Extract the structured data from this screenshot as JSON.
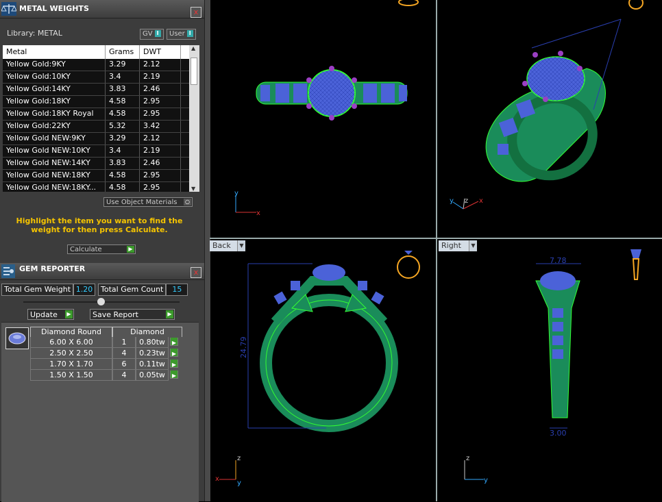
{
  "metal_panel": {
    "title": "METAL WEIGHTS",
    "close": "x",
    "library_label": "Library: METAL",
    "toggle_gv": "GV",
    "toggle_user": "User",
    "toggle_mark": "I",
    "columns": [
      "Metal",
      "Grams",
      "DWT"
    ],
    "rows": [
      {
        "metal": "Yellow Gold:9KY",
        "grams": "3.29",
        "dwt": "2.12"
      },
      {
        "metal": "Yellow Gold:10KY",
        "grams": "3.4",
        "dwt": "2.19"
      },
      {
        "metal": "Yellow Gold:14KY",
        "grams": "3.83",
        "dwt": "2.46"
      },
      {
        "metal": "Yellow Gold:18KY",
        "grams": "4.58",
        "dwt": "2.95"
      },
      {
        "metal": "Yellow Gold:18KY Royal",
        "grams": "4.58",
        "dwt": "2.95"
      },
      {
        "metal": "Yellow Gold:22KY",
        "grams": "5.32",
        "dwt": "3.42"
      },
      {
        "metal": "Yellow Gold NEW:9KY",
        "grams": "3.29",
        "dwt": "2.12"
      },
      {
        "metal": "Yellow Gold NEW:10KY",
        "grams": "3.4",
        "dwt": "2.19"
      },
      {
        "metal": "Yellow Gold NEW:14KY",
        "grams": "3.83",
        "dwt": "2.46"
      },
      {
        "metal": "Yellow Gold NEW:18KY",
        "grams": "4.58",
        "dwt": "2.95"
      },
      {
        "metal": "Yellow Gold NEW:18KY...",
        "grams": "4.58",
        "dwt": "2.95"
      }
    ],
    "use_object_materials": "Use Object Materials",
    "hint": "Highlight the item you want to find the weight for then press Calculate.",
    "calculate": "Calculate"
  },
  "gem_panel": {
    "title": "GEM REPORTER",
    "close": "x",
    "total_weight_label": "Total Gem Weight",
    "total_weight_value": "1.20",
    "total_count_label": "Total Gem Count",
    "total_count_value": "15",
    "update": "Update",
    "save_report": "Save Report",
    "columns": [
      "Diamond Round",
      "Diamond"
    ],
    "rows": [
      {
        "size": "6.00 X 6.00",
        "count": "1",
        "tw": "0.80tw"
      },
      {
        "size": "2.50 X 2.50",
        "count": "4",
        "tw": "0.23tw"
      },
      {
        "size": "1.70 X 1.70",
        "count": "6",
        "tw": "0.11tw"
      },
      {
        "size": "1.50 X 1.50",
        "count": "4",
        "tw": "0.05tw"
      }
    ]
  },
  "viewports": {
    "back_label": "Back",
    "right_label": "Right",
    "dim_width": "7.78",
    "dim_height": "24.79",
    "dim_bottom": "3.00",
    "axes": {
      "x": "x",
      "y": "y",
      "z": "z"
    }
  },
  "colors": {
    "ring": "#1a8c5a",
    "gem": "#3d5bd8",
    "prong": "#9b3fc4",
    "highlight": "#f5c400"
  },
  "icons": [
    "scale-icon",
    "gem-reporter-icon",
    "diamond-icon",
    "ring-icon",
    "pendant-icon"
  ]
}
